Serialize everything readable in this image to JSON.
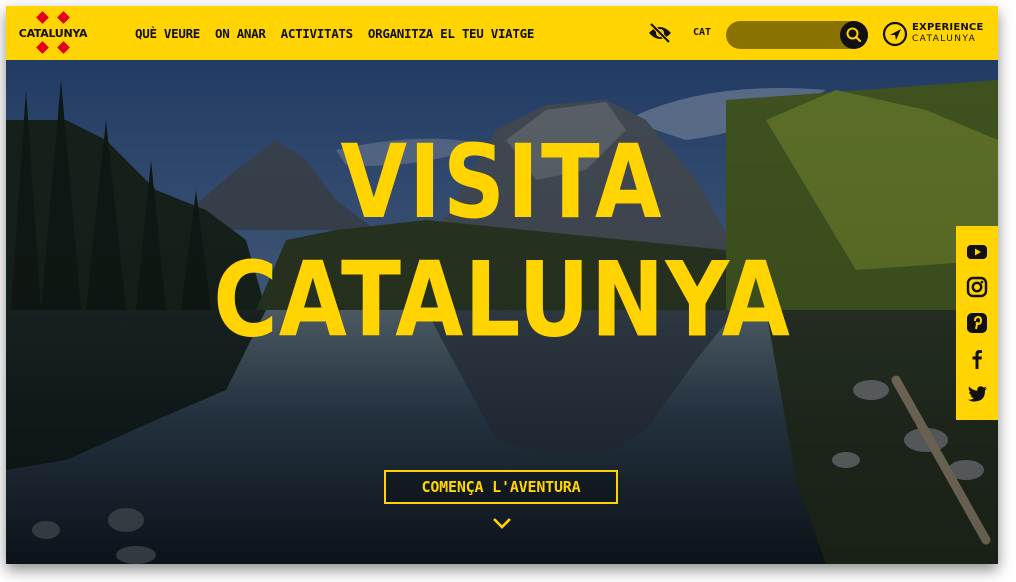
{
  "header": {
    "logo_text": "CATALUNYA",
    "nav": [
      "QUÈ VEURE",
      "ON ANAR",
      "ACTIVITATS",
      "ORGANITZA EL TEU VIATGE"
    ],
    "language": "CAT",
    "search_placeholder": "",
    "experience_top": "EXPERIENCE",
    "experience_bottom": "CATALUNYA",
    "accent_color": "#ffd400"
  },
  "hero": {
    "title_line1": "VISITA",
    "title_line2": "CATALUNYA",
    "cta_label": "COMENÇA L'AVENTURA"
  },
  "social": [
    "youtube-icon",
    "instagram-icon",
    "pinterest-icon",
    "facebook-icon",
    "twitter-icon"
  ]
}
